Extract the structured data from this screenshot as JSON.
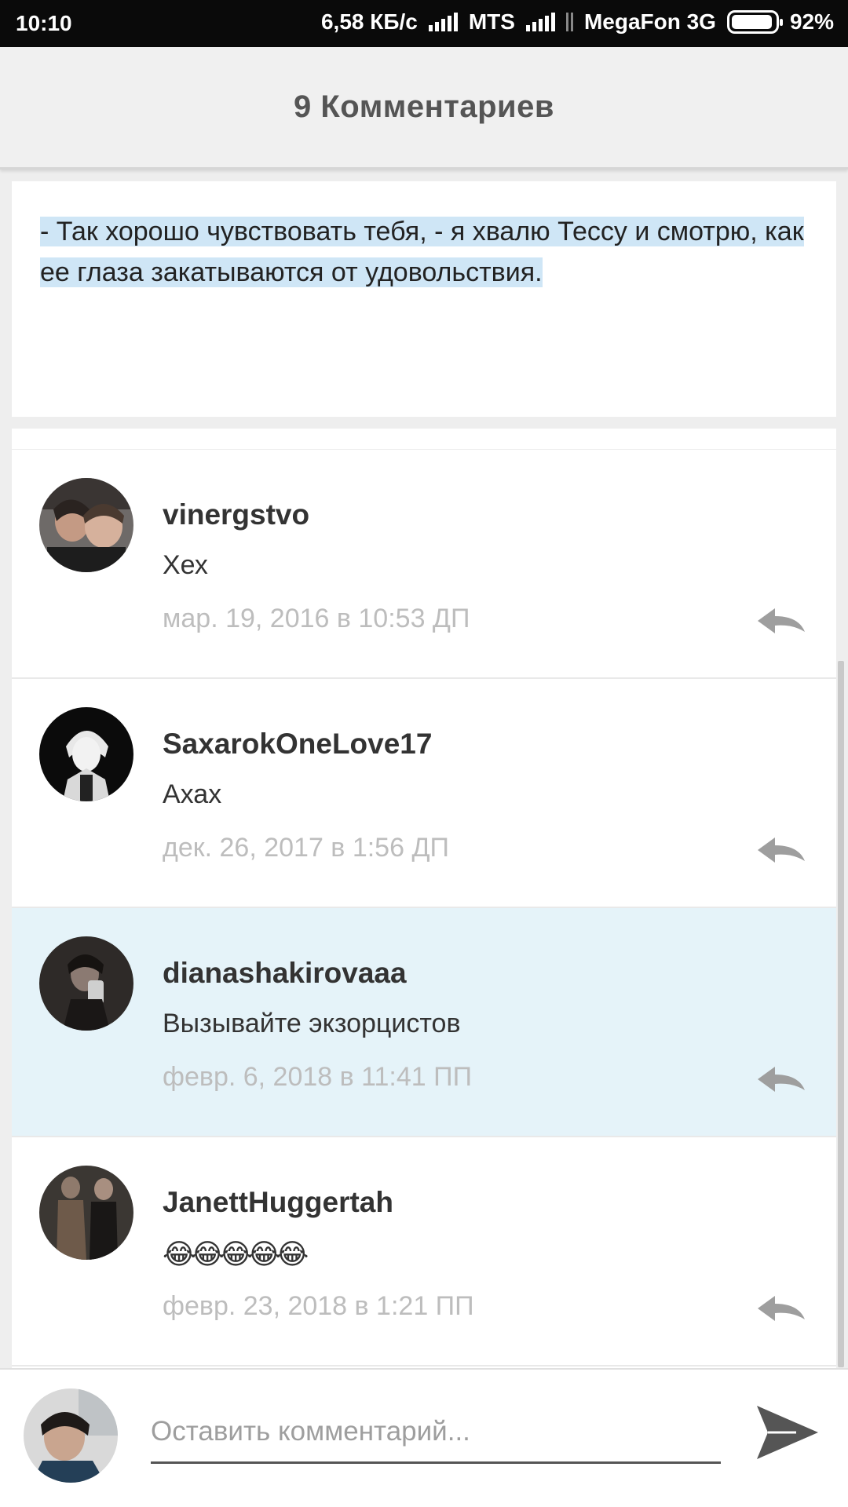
{
  "status_bar": {
    "time": "10:10",
    "speed": "6,58 КБ/с",
    "carrier1": "MTS",
    "carrier2": "MegaFon 3G",
    "battery": "92%"
  },
  "header": {
    "title": "9 Комментариев"
  },
  "quote": {
    "text": "- Так хорошо чувствовать тебя, - я хвалю Тессу и смотрю, как ее глаза закатываются от удовольствия. "
  },
  "comments": [
    {
      "author": "vinergstvo",
      "text": "Хех",
      "date": "мар. 19, 2016 в 10:53 ДП",
      "highlighted": false
    },
    {
      "author": "SaxarokOneLove17",
      "text": "Ахах",
      "date": "дек. 26, 2017 в 1:56 ДП",
      "highlighted": false
    },
    {
      "author": "dianashakirovaaa",
      "text": "Вызывайте экзорцистов",
      "date": "февр. 6, 2018 в 11:41 ПП",
      "highlighted": true
    },
    {
      "author": "JanettHuggertah",
      "text": "😂😂😂😂😂",
      "date": "февр. 23, 2018 в 1:21 ПП",
      "highlighted": false
    }
  ],
  "composer": {
    "placeholder": "Оставить комментарий..."
  },
  "icons": {
    "reply": "reply-arrow-icon",
    "send": "send-icon",
    "signal": "signal-bars-icon",
    "battery": "battery-icon"
  },
  "colors": {
    "highlight_bg": "#e5f3f9",
    "selection": "#cfe6f6",
    "date_gray": "#bdbdbd",
    "header_bg": "#f0f0f0"
  }
}
